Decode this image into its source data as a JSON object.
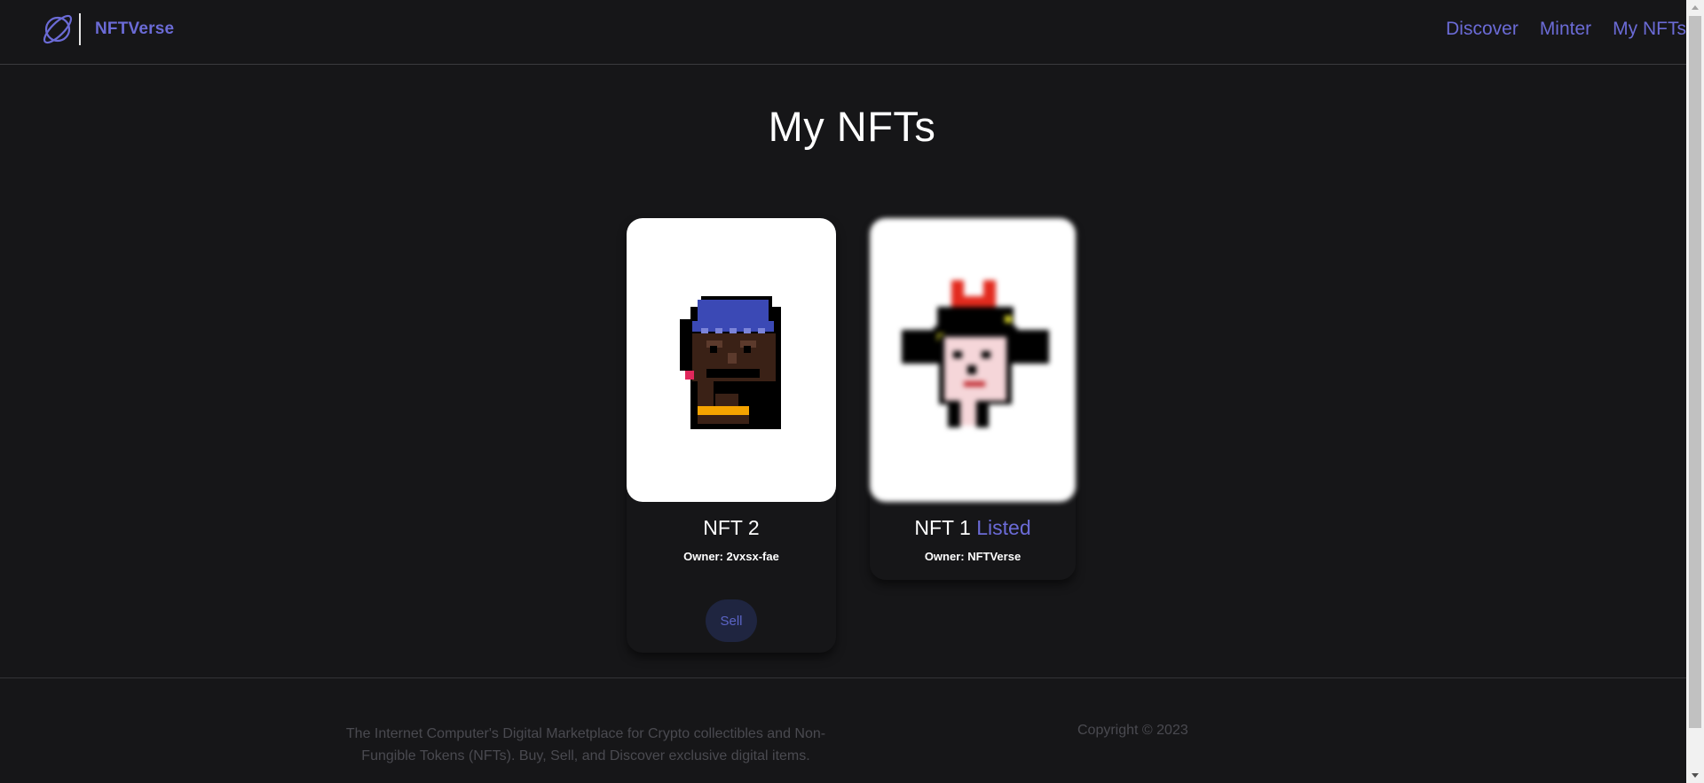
{
  "header": {
    "brand": "NFTVerse",
    "nav": [
      {
        "label": "Discover"
      },
      {
        "label": "Minter"
      },
      {
        "label": "My NFTs"
      }
    ]
  },
  "main": {
    "title": "My NFTs",
    "cards": [
      {
        "name": "NFT 2",
        "status": "",
        "owner": "Owner: 2vxsx-fae",
        "action": "Sell"
      },
      {
        "name": "NFT 1",
        "status": "Listed",
        "owner": "Owner: NFTVerse"
      }
    ]
  },
  "footer": {
    "description": "The Internet Computer's Digital Marketplace for Crypto collectibles and Non-Fungible Tokens (NFTs). Buy, Sell, and Discover exclusive digital items.",
    "copyright": "Copyright © 2023"
  },
  "colors": {
    "background": "#161618",
    "accent": "#6b6bd6",
    "sell_button_bg": "#1f2540",
    "footer_text": "#4a4a50"
  },
  "icons": {
    "logo": "planet-icon"
  }
}
